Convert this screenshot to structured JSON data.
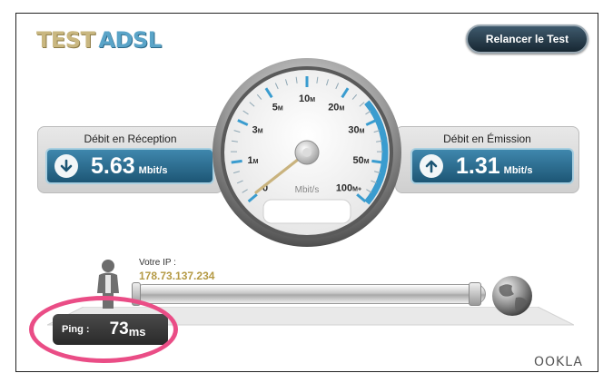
{
  "logo": {
    "part1": "TEST",
    "part2": "ADSL"
  },
  "buttons": {
    "relaunch_label": "Relancer le Test"
  },
  "download": {
    "title": "Débit en Réception",
    "value": "5.63",
    "unit": "Mbit/s",
    "icon": "arrow-down-circle-icon"
  },
  "upload": {
    "title": "Débit en Émission",
    "value": "1.31",
    "unit": "Mbit/s",
    "icon": "arrow-up-circle-icon"
  },
  "gauge": {
    "unit": "Mbit/s",
    "scale": [
      {
        "num": "0",
        "sfx": ""
      },
      {
        "num": "1",
        "sfx": "M"
      },
      {
        "num": "3",
        "sfx": "M"
      },
      {
        "num": "5",
        "sfx": "M"
      },
      {
        "num": "10",
        "sfx": "M"
      },
      {
        "num": "20",
        "sfx": "M"
      },
      {
        "num": "30",
        "sfx": "M"
      },
      {
        "num": "50",
        "sfx": "M"
      },
      {
        "num": "100",
        "sfx": "M+"
      }
    ],
    "needle_value_mbps": 0,
    "accent": "#3a9ccf"
  },
  "ip": {
    "label": "Votre IP :",
    "value": "178.73.137.234"
  },
  "ping": {
    "label": "Ping :",
    "value": "73",
    "unit": "ms"
  },
  "brand": {
    "text": "OOKLA"
  },
  "colors": {
    "highlight": "#ea4d86",
    "ip_text": "#b59a45",
    "readout_blue": "#2a6f93"
  }
}
